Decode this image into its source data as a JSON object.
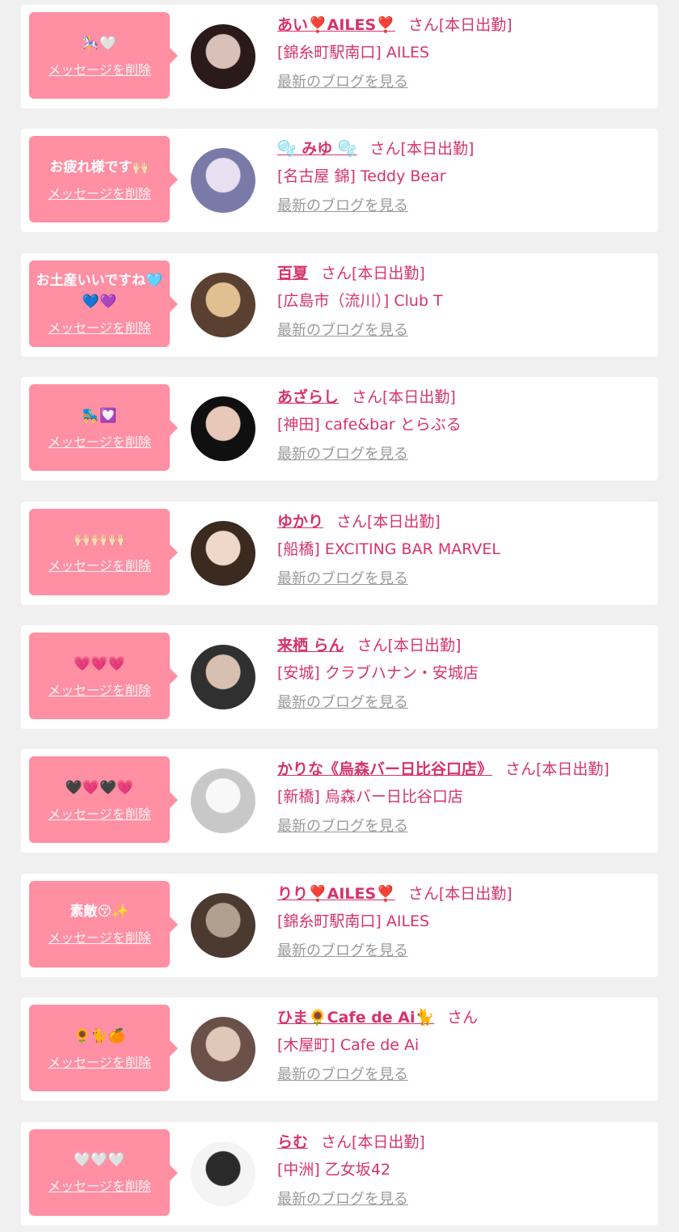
{
  "delete_label": "メッセージを削除",
  "blog_label": "最新のブログを見る",
  "colors": {
    "bubble": "#ff8fa3",
    "accent": "#d6336c",
    "link_gray": "#9a9a9a",
    "background": "#f0f0f0"
  },
  "items": [
    {
      "message": "🎠🤍",
      "name": "あい❣️AILES❣️",
      "suffix": "さん[本日出勤]",
      "shop": "[錦糸町駅南口] AILES",
      "avatar_colors": [
        "#2a1a1a",
        "#d9c0b8"
      ]
    },
    {
      "message": "お疲れ様です🙌🏻",
      "name": "🫧 みゆ 🫧",
      "suffix": "さん[本日出勤]",
      "shop": "[名古屋 錦] Teddy Bear",
      "avatar_colors": [
        "#7a7aa8",
        "#e8e0f0"
      ]
    },
    {
      "message": "お土産いいですね🩵💙💜",
      "name": "百夏",
      "suffix": "さん[本日出勤]",
      "shop": "[広島市（流川）] Club T",
      "avatar_colors": [
        "#5a4030",
        "#e0c090"
      ]
    },
    {
      "message": "🛼💟",
      "name": "あざらし",
      "suffix": "さん[本日出勤]",
      "shop": "[神田] cafe&bar とらぶる",
      "avatar_colors": [
        "#101010",
        "#e8c8b8"
      ]
    },
    {
      "message": "🙌🏻🙌🏻🙌🏻",
      "name": "ゆかり",
      "suffix": "さん[本日出勤]",
      "shop": "[船橋] EXCITING BAR MARVEL",
      "avatar_colors": [
        "#3a2a20",
        "#f0d8c8"
      ]
    },
    {
      "message": "💗💗💗",
      "name": "来栖 らん",
      "suffix": "さん[本日出勤]",
      "shop": "[安城] クラブハナン・安城店",
      "avatar_colors": [
        "#303030",
        "#d8c0b0"
      ]
    },
    {
      "message": "🖤💗🖤💗",
      "name": "かりな《烏森バー日比谷口店》",
      "suffix": "さん[本日出勤]",
      "shop": "[新橋] 烏森バー日比谷口店",
      "avatar_colors": [
        "#c8c8c8",
        "#f8f8f8"
      ]
    },
    {
      "message": "素敵😚✨",
      "name": "りり❣️AILES❣️",
      "suffix": "さん[本日出勤]",
      "shop": "[錦糸町駅南口] AILES",
      "avatar_colors": [
        "#4a3a30",
        "#b0a090"
      ]
    },
    {
      "message": "🌻🐈🍊",
      "name": "ひま🌻Cafe de Ai🐈",
      "suffix": "さん",
      "shop": "[木屋町] Cafe de Ai",
      "avatar_colors": [
        "#6a5048",
        "#e0c8b8"
      ]
    },
    {
      "message": "🤍🤍🤍",
      "name": "らむ",
      "suffix": "さん[本日出勤]",
      "shop": "[中洲] 乙女坂42",
      "avatar_colors": [
        "#f4f4f4",
        "#2a2a2a"
      ]
    }
  ]
}
